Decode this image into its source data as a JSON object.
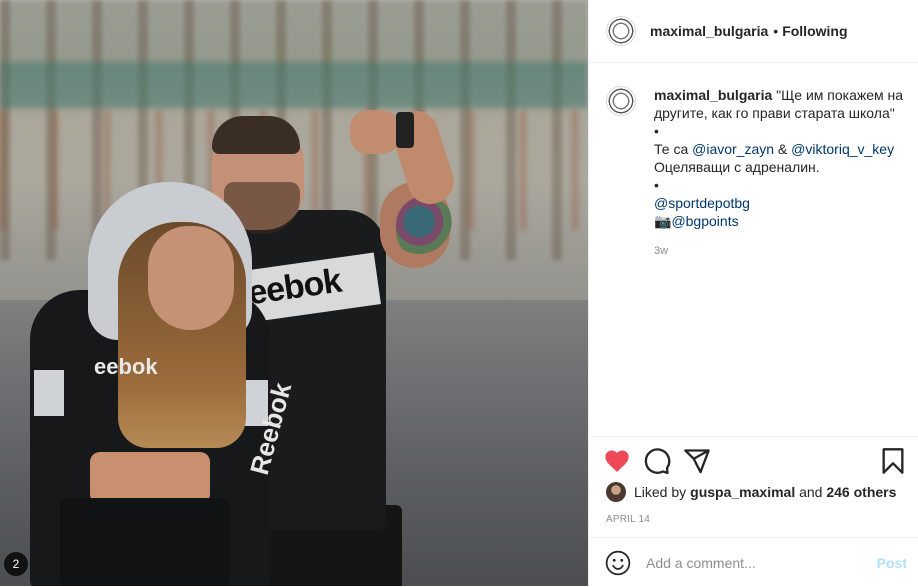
{
  "header": {
    "username": "maximal_bulgaria",
    "separator": "•",
    "follow_status": "Following",
    "more_label": "•••"
  },
  "caption": {
    "username": "maximal_bulgaria",
    "line1": "\"Ще им покажем на другите, как го прави старата школа\"",
    "bullet1": "•",
    "line2_prefix": "Те са ",
    "mention1": "@iavor_zayn",
    "line2_mid": " & ",
    "mention2": "@viktoriq_v_key",
    "line3": "Оцеляващи с адреналин.",
    "bullet2": "•",
    "mention3": "@sportdepotbg",
    "camera_emoji": "📷",
    "mention4": "@bgpoints",
    "time": "3w"
  },
  "photo": {
    "man_shirt_logo": "eebok",
    "woman_top_logo": "eebok",
    "sleeve_logo": "Reebok",
    "corner_badge": "2"
  },
  "actions": {
    "like_icon": "heart-filled-icon",
    "comment_icon": "comment-icon",
    "share_icon": "share-icon",
    "save_icon": "bookmark-icon",
    "like_color": "#ed4956"
  },
  "likes": {
    "prefix": "Liked by ",
    "user": "guspa_maximal",
    "mid": " and ",
    "count": "246 others"
  },
  "date": "APRIL 14",
  "comment_bar": {
    "placeholder": "Add a comment...",
    "post_label": "Post"
  }
}
